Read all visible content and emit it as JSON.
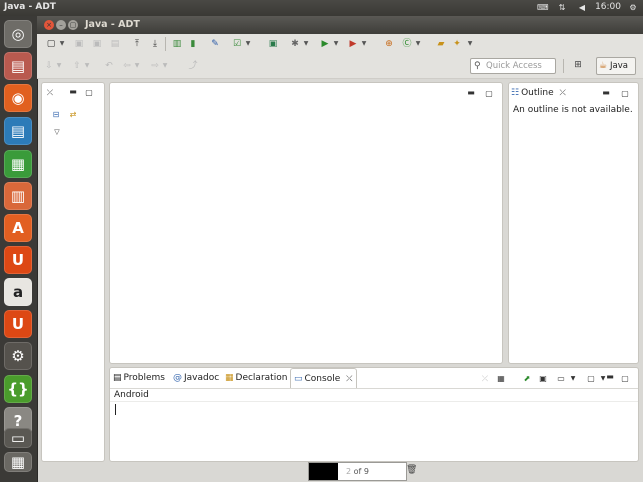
{
  "top_panel": {
    "title": "Java - ADT",
    "clock": "16:00"
  },
  "window": {
    "title": "Java - ADT"
  },
  "quick_access": {
    "placeholder": "Quick Access"
  },
  "perspective": {
    "java_label": "Java"
  },
  "outline": {
    "tab_label": "Outline",
    "message": "An outline is not available."
  },
  "bottom_tabs": [
    {
      "label": "Problems",
      "icon": "problems-icon"
    },
    {
      "label": "Javadoc",
      "icon": "at-icon"
    },
    {
      "label": "Declaration",
      "icon": "declaration-icon"
    },
    {
      "label": "Console",
      "icon": "console-icon"
    }
  ],
  "console": {
    "title": "Android"
  },
  "status_bar": {
    "heap": "2",
    "memory": "of 9",
    "heap_fraction": 0.3
  },
  "launcher": [
    {
      "name": "dash-icon",
      "color": "#6e6c67"
    },
    {
      "name": "file-manager-icon",
      "color": "#b95a4f"
    },
    {
      "name": "firefox-icon",
      "color": "#e1601f"
    },
    {
      "name": "writer-icon",
      "color": "#2c7bb8"
    },
    {
      "name": "calc-icon",
      "color": "#3a9b3a"
    },
    {
      "name": "impress-icon",
      "color": "#d9683a"
    },
    {
      "name": "software-center-icon",
      "color": "#e25f21"
    },
    {
      "name": "ubuntu-one-icon",
      "color": "#dd4814"
    },
    {
      "name": "amazon-icon",
      "color": "#e8e6e1"
    },
    {
      "name": "ubuntu-one-music-icon",
      "color": "#dd4814"
    },
    {
      "name": "system-settings-icon",
      "color": "#55524d"
    },
    {
      "name": "adt-icon",
      "color": "#4a9c2c"
    },
    {
      "name": "help-icon",
      "color": "#8a8883"
    },
    {
      "name": "terminal-icon",
      "color": "#5a5853"
    },
    {
      "name": "workspace-switcher-icon",
      "color": "#6a6863"
    }
  ]
}
